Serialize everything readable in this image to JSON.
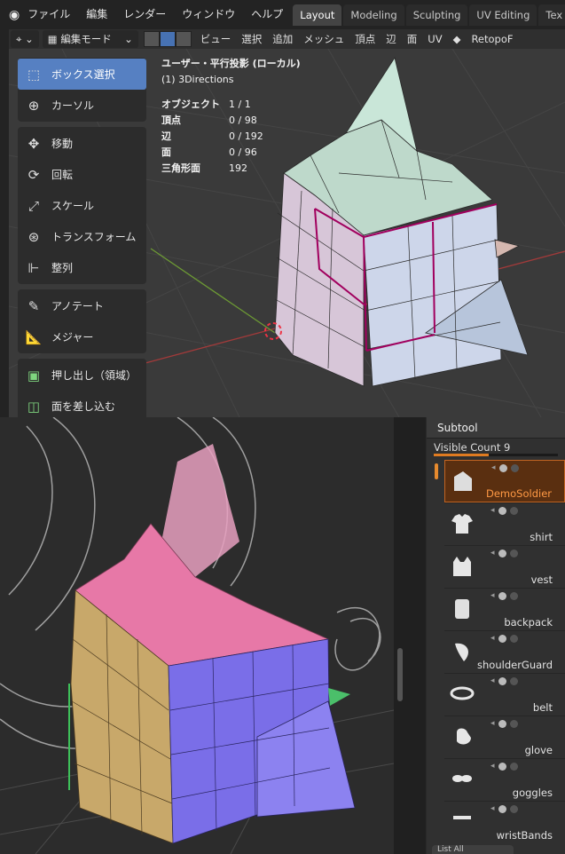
{
  "blender": {
    "menubar": {
      "items": [
        "ファイル",
        "編集",
        "レンダー",
        "ウィンドウ",
        "ヘルプ"
      ],
      "workspace_tabs": [
        "Layout",
        "Modeling",
        "Sculpting",
        "UV Editing",
        "Tex"
      ],
      "active_tab": "Layout"
    },
    "header": {
      "mode": "編集モード",
      "menus": [
        "ビュー",
        "選択",
        "追加",
        "メッシュ",
        "頂点",
        "辺",
        "面",
        "UV"
      ],
      "right_label": "RetopoF"
    },
    "overlay": {
      "view_title": "ユーザー・平行投影 (ローカル)",
      "object_name": "(1) 3Directions",
      "stats": [
        {
          "label": "オブジェクト",
          "value": "1 / 1"
        },
        {
          "label": "頂点",
          "value": "0 / 98"
        },
        {
          "label": "辺",
          "value": "0 / 192"
        },
        {
          "label": "面",
          "value": "0 / 96"
        },
        {
          "label": "三角形面",
          "value": "192"
        }
      ]
    },
    "toolbar": {
      "groups": [
        [
          {
            "label": "ボックス選択",
            "icon": "box-select-icon",
            "active": true
          },
          {
            "label": "カーソル",
            "icon": "cursor-icon"
          }
        ],
        [
          {
            "label": "移動",
            "icon": "move-icon"
          },
          {
            "label": "回転",
            "icon": "rotate-icon"
          },
          {
            "label": "スケール",
            "icon": "scale-icon"
          },
          {
            "label": "トランスフォーム",
            "icon": "transform-icon"
          },
          {
            "label": "整列",
            "icon": "align-icon"
          }
        ],
        [
          {
            "label": "アノテート",
            "icon": "annotate-icon"
          },
          {
            "label": "メジャー",
            "icon": "measure-icon"
          }
        ],
        [
          {
            "label": "押し出し（領域）",
            "icon": "extrude-icon"
          },
          {
            "label": "面を差し込む",
            "icon": "inset-icon"
          }
        ]
      ]
    }
  },
  "zbrush": {
    "subtool": {
      "title": "Subtool",
      "visible_count_label": "Visible Count 9",
      "items": [
        {
          "name": "DemoSoldier",
          "active": true
        },
        {
          "name": "shirt"
        },
        {
          "name": "vest"
        },
        {
          "name": "backpack"
        },
        {
          "name": "shoulderGuard"
        },
        {
          "name": "belt"
        },
        {
          "name": "glove"
        },
        {
          "name": "goggles"
        },
        {
          "name": "wristBands"
        }
      ],
      "list_all_label": "List All"
    }
  },
  "colors": {
    "blender_accent": "#5680c2",
    "edge_selected": "#a1005e",
    "mesh_face": "#b9c6dc",
    "zb_pink": "#e778a7",
    "zb_purple": "#7a6ee8",
    "zb_yellow": "#c8a86a",
    "zb_accent": "#e07b20"
  }
}
